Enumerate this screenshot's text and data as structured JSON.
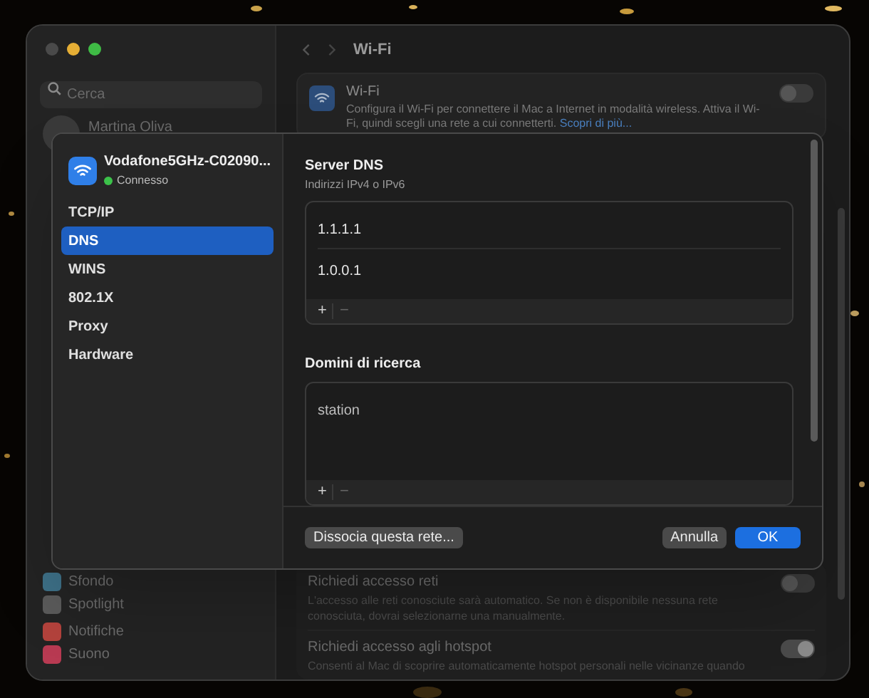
{
  "window": {
    "title": "Wi-Fi"
  },
  "sidebar": {
    "search": {
      "placeholder": "Cerca"
    },
    "account": {
      "name": "Martina Oliva"
    },
    "item_groups": [
      {
        "items": [
          {
            "label": "Sfondo",
            "color": "#3d6f86"
          },
          {
            "label": "Spotlight",
            "color": "#5a5a5a"
          }
        ]
      },
      {
        "items": [
          {
            "label": "Notifiche",
            "color": "#b3423c"
          },
          {
            "label": "Suono",
            "color": "#b83a52"
          }
        ]
      }
    ]
  },
  "wifi_card": {
    "title": "Wi-Fi",
    "description": "Configura il Wi-Fi per connettere il Mac a Internet in modalità wireless. Attiva il Wi-Fi, quindi scegli una rete a cui connetterti.",
    "link": "Scopri di più...",
    "on": false
  },
  "settings": [
    {
      "title": "Richiedi accesso reti",
      "description": "L'accesso alle reti conosciute sarà automatico. Se non è disponibile nessuna rete conosciuta, dovrai selezionarne una manualmente.",
      "on": false
    },
    {
      "title": "Richiedi accesso agli hotspot",
      "description": "Consenti al Mac di scoprire automaticamente hotspot personali nelle vicinanze quando",
      "on": true
    }
  ],
  "sheet": {
    "network": {
      "name": "Vodafone5GHz-C02090...",
      "status": "Connesso",
      "connected": true
    },
    "tabs": [
      {
        "label": "TCP/IP",
        "selected": false
      },
      {
        "label": "DNS",
        "selected": true
      },
      {
        "label": "WINS",
        "selected": false
      },
      {
        "label": "802.1X",
        "selected": false
      },
      {
        "label": "Proxy",
        "selected": false
      },
      {
        "label": "Hardware",
        "selected": false
      }
    ],
    "dns": {
      "title": "Server DNS",
      "subtitle": "Indirizzi IPv4 o IPv6",
      "entries": [
        "1.1.1.1",
        "1.0.0.1"
      ],
      "add": "+",
      "remove": "−"
    },
    "search_domains": {
      "title": "Domini di ricerca",
      "entries": [
        "station"
      ],
      "add": "+",
      "remove": "−"
    },
    "buttons": [
      {
        "label": "Dissocia questa rete...",
        "kind": "secondary"
      },
      {
        "label": "Annulla",
        "kind": "secondary"
      },
      {
        "label": "OK",
        "kind": "primary"
      }
    ]
  }
}
